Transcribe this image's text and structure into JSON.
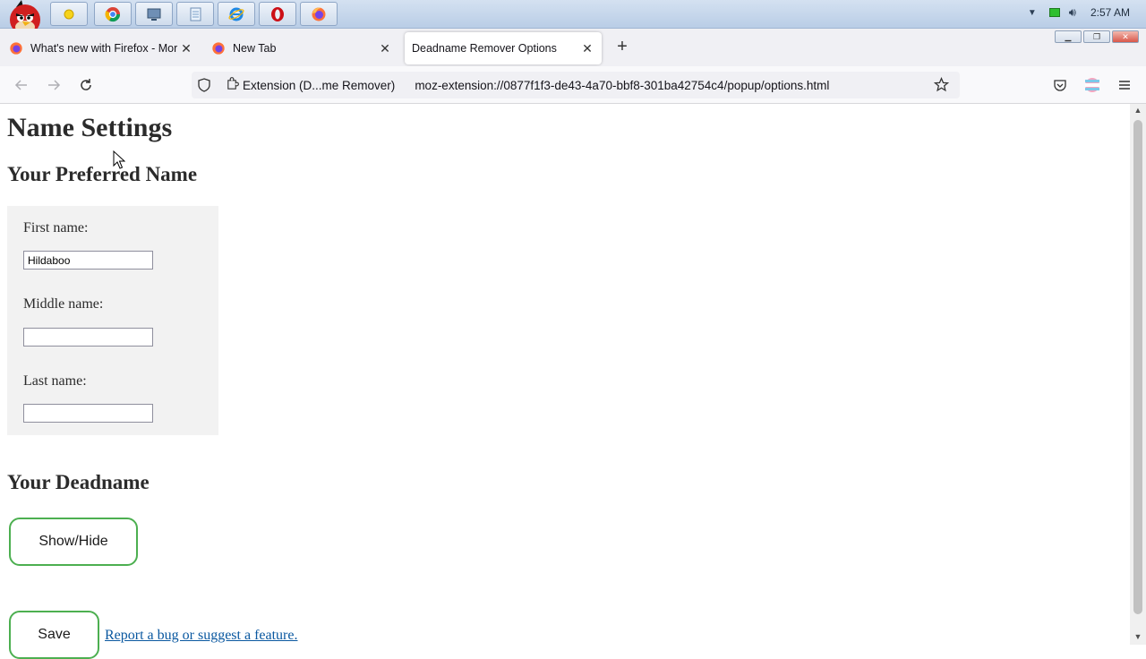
{
  "taskbar": {
    "apps": [
      {
        "icon": "sun-weather-icon"
      },
      {
        "icon": "chrome-icon"
      },
      {
        "icon": "screen-icon"
      },
      {
        "icon": "notepad-icon"
      },
      {
        "icon": "internet-explorer-icon"
      },
      {
        "icon": "opera-icon"
      },
      {
        "icon": "firefox-icon"
      }
    ],
    "clock": "2:57 AM"
  },
  "tabs": [
    {
      "label": "What's new with Firefox - More",
      "active": false
    },
    {
      "label": "New Tab",
      "active": false
    },
    {
      "label": "Deadname Remover Options",
      "active": true
    }
  ],
  "navbar": {
    "identity_label": "Extension (D...me Remover)",
    "url": "moz-extension://0877f1f3-de43-4a70-bbf8-301ba42754c4/popup/options.html"
  },
  "page": {
    "title": "Name Settings",
    "preferred_heading": "Your Preferred Name",
    "first_name_label": "First name:",
    "first_name_value": "Hildaboo",
    "middle_name_label": "Middle name:",
    "middle_name_value": "",
    "last_name_label": "Last name:",
    "last_name_value": "",
    "deadname_heading": "Your Deadname",
    "show_hide_label": "Show/Hide",
    "save_label": "Save",
    "report_link": "Report a bug or suggest a feature."
  },
  "colors": {
    "button_border": "#4caf50",
    "link": "#0a58a0",
    "name_box_bg": "#f2f2f2"
  }
}
